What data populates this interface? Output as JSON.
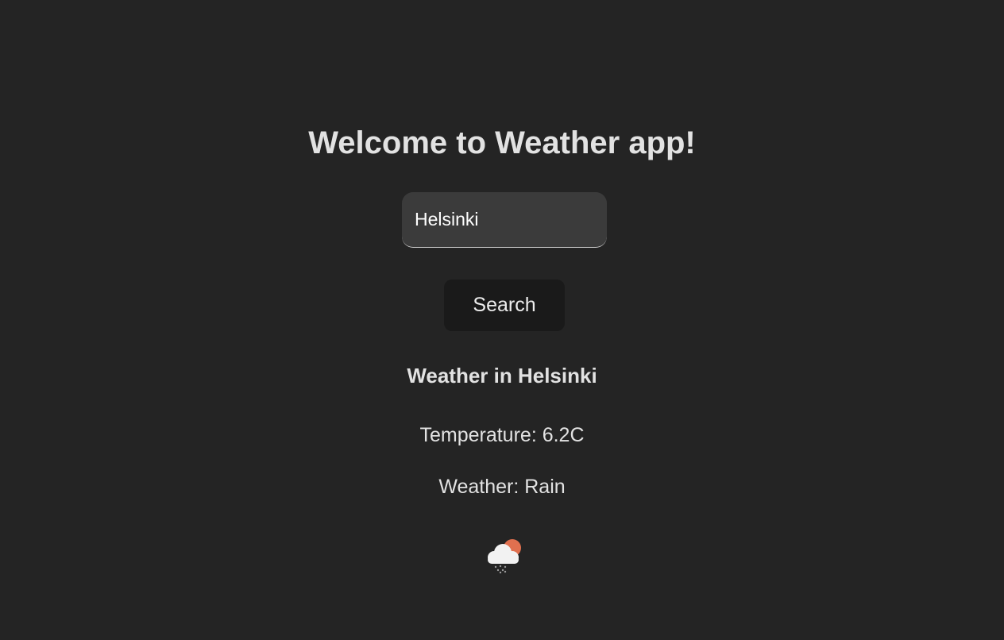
{
  "header": {
    "title": "Welcome to Weather app!"
  },
  "search": {
    "value": "Helsinki",
    "button_label": "Search"
  },
  "result": {
    "heading": "Weather in Helsinki",
    "temperature_line": "Temperature: 6.2C",
    "weather_line": "Weather: Rain",
    "icon": "cloud-sun-rain-icon"
  },
  "colors": {
    "background": "#242424",
    "input_background": "#3b3b3b",
    "button_background": "#1a1a1a",
    "sun": "#e0704f",
    "cloud": "#f2f2f2"
  }
}
